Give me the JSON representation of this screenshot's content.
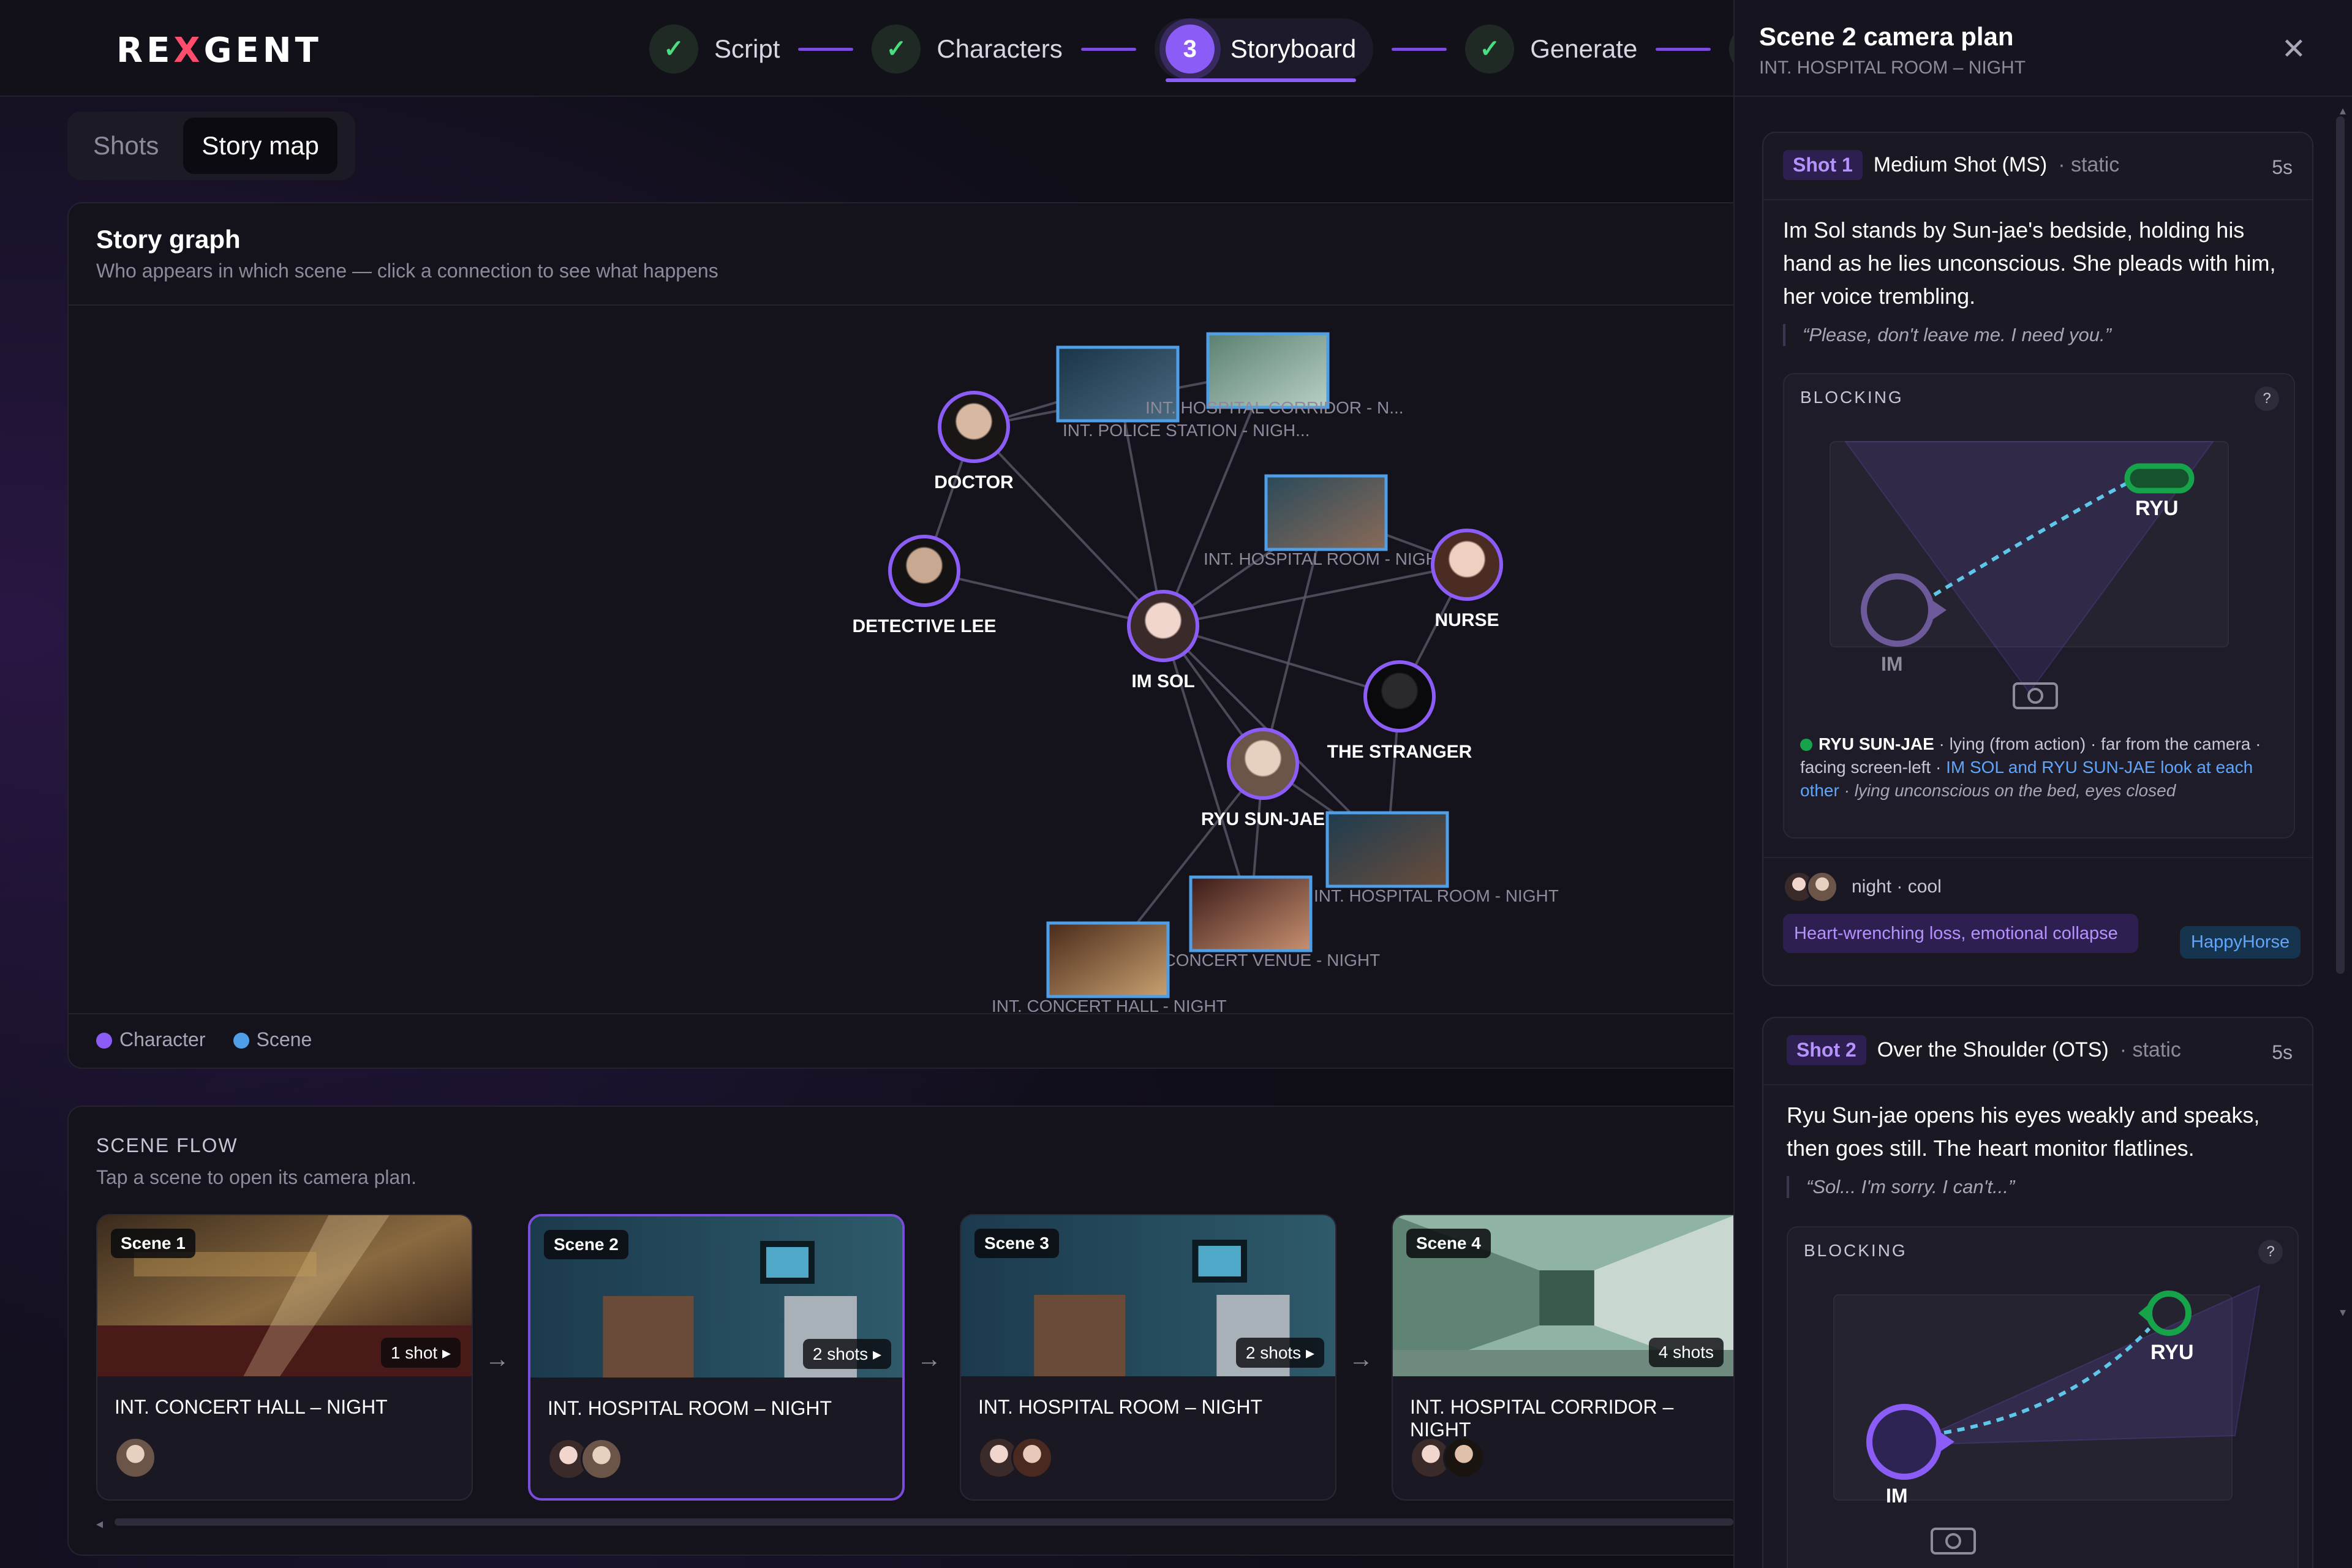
{
  "app": {
    "logo_part1": "RE",
    "logo_x": "X",
    "logo_part2": "GENT"
  },
  "stepper": [
    {
      "label": "Script",
      "state": "done",
      "mark": "✓"
    },
    {
      "label": "Characters",
      "state": "done",
      "mark": "✓"
    },
    {
      "label": "Storyboard",
      "state": "active",
      "mark": "3"
    },
    {
      "label": "Generate",
      "state": "done",
      "mark": "✓"
    },
    {
      "label": "",
      "state": "done",
      "mark": "✓"
    }
  ],
  "tabs": {
    "shots": "Shots",
    "story_map": "Story map",
    "active": "Story map"
  },
  "story_graph": {
    "title": "Story graph",
    "subtitle": "Who appears in which scene — click a connection to see what happens",
    "legend": [
      {
        "label": "Character",
        "color": "#8b5cf6"
      },
      {
        "label": "Scene",
        "color": "#4f9fe8"
      }
    ],
    "characters": [
      {
        "id": "doctor",
        "label": "DOCTOR"
      },
      {
        "id": "lee",
        "label": "DETECTIVE LEE"
      },
      {
        "id": "imsol",
        "label": "IM SOL"
      },
      {
        "id": "nurse",
        "label": "NURSE"
      },
      {
        "id": "stranger",
        "label": "THE STRANGER"
      },
      {
        "id": "ryu",
        "label": "RYU SUN-JAE"
      }
    ],
    "scenes": [
      {
        "id": "police",
        "label": "INT. POLICE STATION - NIGH..."
      },
      {
        "id": "corridor",
        "label": "INT. HOSPITAL CORRIDOR - N..."
      },
      {
        "id": "room1",
        "label": "INT. HOSPITAL ROOM - NIGHT"
      },
      {
        "id": "room2",
        "label": "INT. HOSPITAL ROOM - NIGHT"
      },
      {
        "id": "venue",
        "label": "INT. CONCERT VENUE - NIGHT"
      },
      {
        "id": "hall",
        "label": "INT. CONCERT HALL - NIGHT"
      }
    ],
    "links": [
      [
        "doctor",
        "police"
      ],
      [
        "doctor",
        "corridor"
      ],
      [
        "doctor",
        "imsol"
      ],
      [
        "lee",
        "imsol"
      ],
      [
        "imsol",
        "police"
      ],
      [
        "imsol",
        "corridor"
      ],
      [
        "imsol",
        "room1"
      ],
      [
        "imsol",
        "nurse"
      ],
      [
        "imsol",
        "stranger"
      ],
      [
        "imsol",
        "ryu"
      ],
      [
        "imsol",
        "room2"
      ],
      [
        "ryu",
        "room1"
      ],
      [
        "ryu",
        "venue"
      ],
      [
        "ryu",
        "room2"
      ],
      [
        "stranger",
        "nurse"
      ],
      [
        "stranger",
        "room2"
      ],
      [
        "nurse",
        "room1"
      ],
      [
        "imsol",
        "venue"
      ],
      [
        "hall",
        "ryu"
      ],
      [
        "lee",
        "doctor"
      ]
    ]
  },
  "scene_flow": {
    "title": "SCENE FLOW",
    "subtitle": "Tap a scene to open its camera plan.",
    "scenes": [
      {
        "badge": "Scene 1",
        "shots": "1 shot ▸",
        "name": "INT. CONCERT HALL – NIGHT",
        "selected": false
      },
      {
        "badge": "Scene 2",
        "shots": "2 shots ▸",
        "name": "INT. HOSPITAL ROOM – NIGHT",
        "selected": true
      },
      {
        "badge": "Scene 3",
        "shots": "2 shots ▸",
        "name": "INT. HOSPITAL ROOM – NIGHT",
        "selected": false
      },
      {
        "badge": "Scene 4",
        "shots": "4 shots",
        "name": "INT. HOSPITAL CORRIDOR – NIGHT",
        "selected": false
      }
    ],
    "arrow": "→"
  },
  "panel": {
    "title": "Scene 2 camera plan",
    "subtitle": "INT. HOSPITAL ROOM – NIGHT",
    "close": "✕",
    "shots": [
      {
        "tag": "Shot 1",
        "type": "Medium Shot (MS)",
        "motion": "· static",
        "duration": "5s",
        "description": "Im Sol stands by Sun-jae's bedside, holding his hand as he lies unconscious. She pleads with him, her voice trembling.",
        "quote": "“Please, don't leave me. I need you.”",
        "blocking_title": "BLOCKING",
        "help": "?",
        "actor_a": "IM",
        "actor_b": "RYU",
        "note_name": "RYU SUN-JAE",
        "note_text": " · lying (from action) · far from the camera · facing screen-left · ",
        "note_highlight": "IM SOL and RYU SUN-JAE look at each other",
        "note_tail": " · lying unconscious on the bed, eyes closed",
        "mood": "night · cool",
        "emotion": "Heart-wrenching loss, emotional collapse",
        "model": "HappyHorse"
      },
      {
        "tag": "Shot 2",
        "type": "Over the Shoulder (OTS)",
        "motion": "· static",
        "duration": "5s",
        "description": "Ryu Sun-jae opens his eyes weakly and speaks, then goes still. The heart monitor flatlines.",
        "quote": "“Sol... I'm sorry. I can't...”",
        "blocking_title": "BLOCKING",
        "help": "?",
        "actor_a": "IM",
        "actor_b": "RYU"
      }
    ]
  },
  "colors": {
    "accent": "#8b5cf6",
    "success": "#4ade80",
    "scene_blue": "#4f9fe8",
    "link": "#60a5fa"
  }
}
